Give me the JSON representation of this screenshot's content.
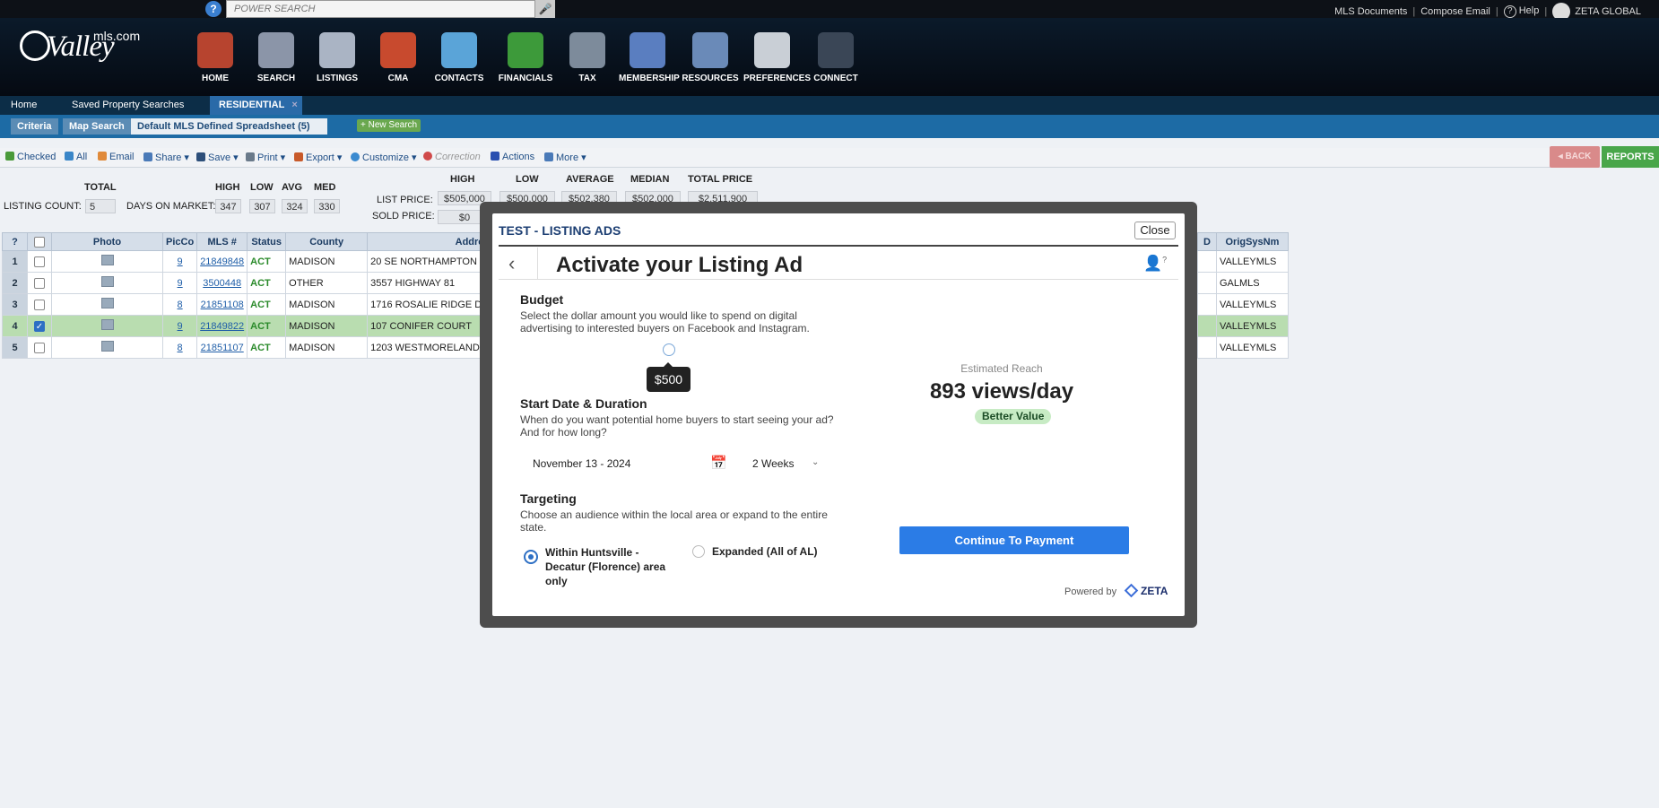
{
  "topbar": {
    "help_q": "?",
    "search_placeholder": "POWER SEARCH",
    "links": [
      "MLS Documents",
      "Compose Email",
      "Help"
    ],
    "user": "ZETA GLOBAL"
  },
  "header": {
    "logo": "Valley",
    "logo_suffix": "mls.com",
    "nav": [
      "HOME",
      "SEARCH",
      "LISTINGS",
      "CMA",
      "CONTACTS",
      "FINANCIALS",
      "TAX",
      "MEMBERSHIP",
      "RESOURCES",
      "PREFERENCES",
      "CONNECT"
    ],
    "nav_icons": [
      "home-icon",
      "search-icon",
      "listings-icon",
      "cma-icon",
      "contacts-icon",
      "financials-icon",
      "tax-icon",
      "membership-icon",
      "resources-icon",
      "preferences-icon",
      "connect-icon"
    ]
  },
  "tabs": {
    "home": "Home",
    "saved": "Saved Property Searches",
    "residential": "RESIDENTIAL",
    "close": "×"
  },
  "subtabs": {
    "criteria": "Criteria",
    "map": "Map Search",
    "spreadsheet": "Default MLS Defined Spreadsheet (5)",
    "new_search": "+ New Search"
  },
  "toolbar": {
    "checked": "Checked",
    "all": "All",
    "email": "Email",
    "share": "Share",
    "save": "Save",
    "print": "Print",
    "export": "Export",
    "customize": "Customize",
    "correction": "Correction",
    "actions": "Actions",
    "more": "More",
    "back": "BACK",
    "reports": "REPORTS"
  },
  "summary": {
    "total_hdr": "TOTAL",
    "high_hdr": "HIGH",
    "low_hdr": "LOW",
    "avg_hdr": "AVG",
    "med_hdr": "MED",
    "listing_count_label": "LISTING COUNT:",
    "listing_count": "5",
    "dom_label": "DAYS ON MARKET:",
    "dom_high": "347",
    "dom_low": "307",
    "dom_avg": "324",
    "dom_med": "330",
    "price_high_hdr": "HIGH",
    "price_low_hdr": "LOW",
    "price_avg_hdr": "AVERAGE",
    "price_med_hdr": "MEDIAN",
    "price_total_hdr": "TOTAL PRICE",
    "list_price_label": "LIST PRICE:",
    "sold_price_label": "SOLD PRICE:",
    "list_high": "$505,000",
    "list_low": "$500,000",
    "list_avg": "$502,380",
    "list_med": "$502,000",
    "list_total": "$2,511,900",
    "sold_high": "$0"
  },
  "grid": {
    "headers": [
      "?",
      "",
      "Photo",
      "PicCo",
      "MLS #",
      "Status",
      "County",
      "Address"
    ],
    "right_headers": [
      "D",
      "OrigSysNm"
    ],
    "rows": [
      {
        "n": "1",
        "pic": "9",
        "mls": "21849848",
        "status": "ACT",
        "county": "MADISON",
        "address": "20 SE NORTHAMPTON DRIVE",
        "sys": "VALLEYMLS"
      },
      {
        "n": "2",
        "pic": "9",
        "mls": "3500448",
        "status": "ACT",
        "county": "OTHER",
        "address": "3557 HIGHWAY 81",
        "sys": "GALMLS"
      },
      {
        "n": "3",
        "pic": "8",
        "mls": "21851108",
        "status": "ACT",
        "county": "MADISON",
        "address": "1716 ROSALIE RIDGE DRIVE",
        "sys": "VALLEYMLS"
      },
      {
        "n": "4",
        "pic": "9",
        "mls": "21849822",
        "status": "ACT",
        "county": "MADISON",
        "address": "107 CONIFER COURT",
        "sys": "VALLEYMLS"
      },
      {
        "n": "5",
        "pic": "8",
        "mls": "21851107",
        "status": "ACT",
        "county": "MADISON",
        "address": "1203 WESTMORELAND AVENUE",
        "sys": "VALLEYMLS"
      }
    ],
    "checked_row": 4
  },
  "modal": {
    "title": "TEST - LISTING ADS",
    "close": "Close",
    "heading": "Activate your Listing Ad",
    "budget_title": "Budget",
    "budget_desc": "Select the dollar amount you would like to spend on digital advertising to interested buyers on Facebook and Instagram.",
    "budget_value": "$500",
    "date_title": "Start Date & Duration",
    "date_desc": "When do you want potential home buyers to start seeing your ad? And for how long?",
    "start_date": "November 13 - 2024",
    "duration": "2 Weeks",
    "targeting_title": "Targeting",
    "targeting_desc": "Choose an audience within the local area or expand to the entire state.",
    "option_local": "Within Huntsville - Decatur (Florence) area only",
    "option_expanded": "Expanded (All of AL)",
    "reach_label": "Estimated Reach",
    "reach_value": "893 views/day",
    "value_badge": "Better Value",
    "pay_button": "Continue To Payment",
    "powered_by": "Powered by",
    "brand": "ZETA"
  },
  "colors": {
    "accent": "#2b7ce6",
    "nav_bg": "#0c2d47",
    "selected_row": "#b9ddb0",
    "status_green": "#2a8a2a"
  }
}
